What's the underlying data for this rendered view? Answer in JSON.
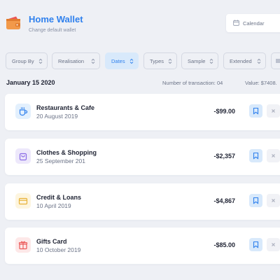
{
  "header": {
    "title": "Home Wallet",
    "subtitle": "Change default wallet",
    "wallet_icon": "wallet-icon",
    "calendar_icon": "calendar-icon",
    "calendar_label": "Calendar"
  },
  "filters": [
    {
      "label": "Group By",
      "active": false
    },
    {
      "label": "Realisation",
      "active": false
    },
    {
      "label": "Dates",
      "active": true
    },
    {
      "label": "Types",
      "active": false
    },
    {
      "label": "Sample",
      "active": false
    },
    {
      "label": "Extended",
      "active": false
    }
  ],
  "section": {
    "date": "January 15 2020",
    "count_text": "Number of transaction: 04",
    "value_text": "Value: $7408."
  },
  "transactions": [
    {
      "name": "Restaurants & Cafe",
      "date": "20 August 2019",
      "amount": "-$99.00",
      "icon": "coffee-icon",
      "icon_color": "#2f80ed",
      "icon_bg": "#e3f0fd"
    },
    {
      "name": "Clothes & Shopping",
      "date": "25 September 201",
      "amount": "-$2,357",
      "icon": "shopping-bag-icon",
      "icon_color": "#8b6ce6",
      "icon_bg": "#ede8fb"
    },
    {
      "name": "Credit & Loans",
      "date": "10 April 2019",
      "amount": "-$4,867",
      "icon": "credit-card-icon",
      "icon_color": "#e8b236",
      "icon_bg": "#fdf5df"
    },
    {
      "name": "Gifts Card",
      "date": "10 October 2019",
      "amount": "-$85.00",
      "icon": "gift-icon",
      "icon_color": "#eb5757",
      "icon_bg": "#fde8e8"
    }
  ],
  "colors": {
    "accent": "#2f80ed",
    "background": "#eef0f5",
    "card": "#ffffff",
    "bookmark_bg": "#d8e9fb"
  }
}
